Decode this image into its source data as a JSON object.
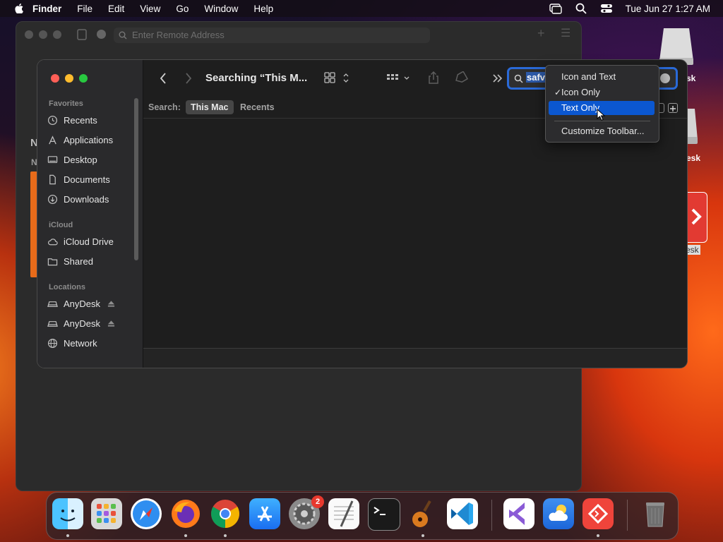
{
  "menubar": {
    "app_name": "Finder",
    "items": [
      "File",
      "Edit",
      "View",
      "Go",
      "Window",
      "Help"
    ],
    "clock": "Tue Jun 27  1:27 AM"
  },
  "desktop": {
    "labels": [
      "sk",
      "esk",
      "esk"
    ]
  },
  "anydesk_window": {
    "address_placeholder": "Enter Remote Address",
    "side_letters": [
      "N",
      "N"
    ]
  },
  "finder": {
    "title": "Searching “This M...",
    "sidebar": {
      "favorites_header": "Favorites",
      "favorites": [
        {
          "label": "Recents",
          "icon": "clock-icon"
        },
        {
          "label": "Applications",
          "icon": "applications-icon"
        },
        {
          "label": "Desktop",
          "icon": "desktop-icon"
        },
        {
          "label": "Documents",
          "icon": "document-icon"
        },
        {
          "label": "Downloads",
          "icon": "download-icon"
        }
      ],
      "icloud_header": "iCloud",
      "icloud": [
        {
          "label": "iCloud Drive",
          "icon": "cloud-icon"
        },
        {
          "label": "Shared",
          "icon": "shared-folder-icon"
        }
      ],
      "locations_header": "Locations",
      "locations": [
        {
          "label": "AnyDesk",
          "icon": "drive-icon"
        },
        {
          "label": "AnyDesk",
          "icon": "drive-icon"
        },
        {
          "label": "Network",
          "icon": "network-icon"
        }
      ]
    },
    "search": {
      "label": "Search:",
      "scopes": [
        "This Mac",
        "Recents"
      ],
      "active_scope": "This Mac",
      "query": "safv"
    }
  },
  "context_menu": {
    "items": [
      "Icon and Text",
      "Icon Only",
      "Text Only",
      "Customize Toolbar..."
    ],
    "checked": "Icon Only",
    "highlighted": "Text Only"
  },
  "dock": {
    "apps": [
      "Finder",
      "Launchpad",
      "Safari",
      "Firefox",
      "Chrome",
      "App Store",
      "System Settings",
      "TextEdit",
      "Terminal",
      "GarageBand",
      "Visual Studio Code",
      "Visual Studio",
      "Weather",
      "AnyDesk",
      "Trash"
    ],
    "settings_badge": "2"
  },
  "colors": {
    "accent": "#0b57d0",
    "search_focus": "#2a6ad8"
  }
}
